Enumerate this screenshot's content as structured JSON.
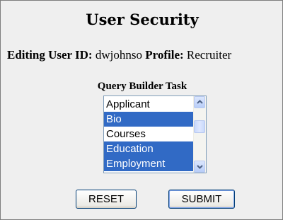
{
  "page": {
    "title": "User Security"
  },
  "user_info": {
    "user_id_label": "Editing User ID:",
    "user_id_value": "dwjohnso",
    "profile_label": "Profile:",
    "profile_value": "Recruiter"
  },
  "query_builder": {
    "label": "Query Builder Task",
    "options": [
      {
        "label": "Applicant",
        "selected": false
      },
      {
        "label": "Bio",
        "selected": true
      },
      {
        "label": "Courses",
        "selected": false
      },
      {
        "label": "Education",
        "selected": true
      },
      {
        "label": "Employment",
        "selected": true
      }
    ]
  },
  "buttons": {
    "reset_label": "RESET",
    "submit_label": "SUBMIT"
  },
  "colors": {
    "selection_background": "#316ac5",
    "panel_background": "#efefef"
  },
  "icons": {
    "scroll_up": "chevron-up-icon",
    "scroll_down": "chevron-down-icon"
  }
}
